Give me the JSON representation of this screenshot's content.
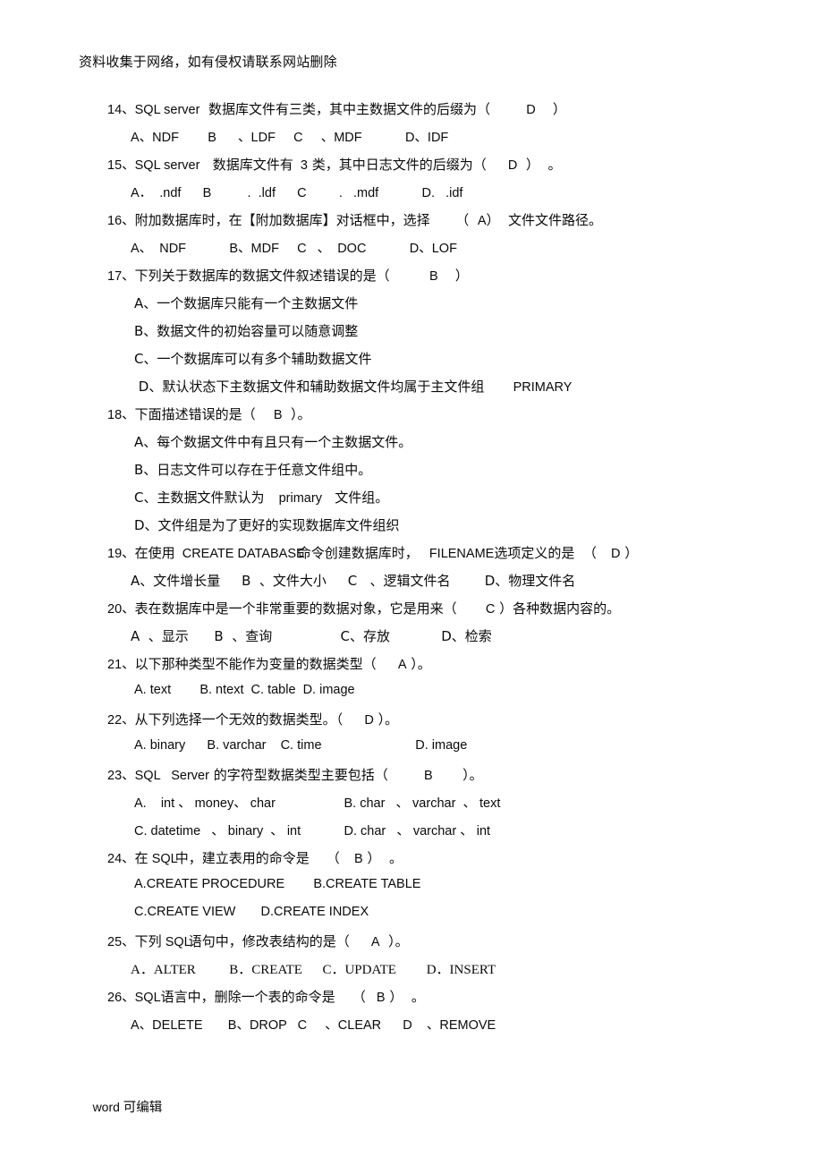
{
  "document": {
    "header_note": "资料收集于网络，如有侵权请联系网站删除",
    "footer_note_latin": "word ",
    "footer_note_cn": "可编辑"
  },
  "questions": [
    {
      "number": "14、",
      "stem_a": "SQL server",
      "stem_b": "数据库文件有三类，其中主数据文件的后缀为（",
      "answer": "D",
      "stem_c": "）",
      "options_line": "A、NDF        B      、LDF     C     、MDF            D、IDF"
    },
    {
      "number": "15、",
      "stem_a": "SQL server",
      "stem_b": "数据库文件有",
      "stem_num": "3",
      "stem_b2": "类，其中日志文件的后缀为（",
      "answer": "D",
      "stem_c": "）  。",
      "options_line": "A．  .ndf      B          .  .ldf      C         .   .mdf            D.   .idf"
    },
    {
      "number": "16、",
      "stem_b": "附加数据库时，在【附加数据库】对话框中，选择",
      "paren_open": "（  ",
      "answer": "A",
      "paren_close": "）",
      "stem_c": "  文件文件路径。",
      "options_line": "A、  NDF            B、MDF     C   、  DOC            D、LOF"
    },
    {
      "number": "17、",
      "stem_b": "下列关于数据库的数据文件叙述错误的是（",
      "answer": "B",
      "stem_c": "）",
      "options": [
        "A、一个数据库只能有一个主数据文件",
        "B、数据文件的初始容量可以随意调整",
        "C、一个数据库可以有多个辅助数据文件"
      ],
      "option_d_cn": " D、默认状态下主数据文件和辅助数据文件均属于主文件组",
      "option_d_latin": "PRIMARY"
    },
    {
      "number": "18、",
      "stem_b": "下面描述错误的是（",
      "answer": "B",
      "stem_c": "）。",
      "options": [
        "A、每个数据文件中有且只有一个主数据文件。",
        "B、日志文件可以存在于任意文件组中。"
      ],
      "option_c_pre": "C、主数据文件默认为",
      "option_c_mid": "primary",
      "option_c_post": "文件组。",
      "option_d": "D、文件组是为了更好的实现数据库文件组织"
    },
    {
      "number": "19、",
      "stem_a": "在使用",
      "stem_cmd": "CREATE DATABASE",
      "stem_b": "命令创建数据库时，",
      "stem_opt": "FILENAME",
      "stem_b2": "选项定义的是",
      "paren_open": "（",
      "answer": "D",
      "paren_close": "）",
      "options_line": "A、文件增长量     B  、文件大小     C   、逻辑文件名        D、物理文件名"
    },
    {
      "number": "20、",
      "stem_b": "表在数据库中是一个非常重要的数据对象，它是用来（",
      "answer": "C",
      "stem_c": "）各种数据内容的。",
      "options_line": "A  、显示      B  、查询                C、存放            D、检索"
    },
    {
      "number": "21、",
      "stem_b": "以下那种类型不能作为变量的数据类型（",
      "answer": "A",
      "stem_c": "）。",
      "options_line": "A. text        B. ntext  C. table  D. image"
    },
    {
      "number": "22、",
      "stem_b": "从下列选择一个无效的数据类型。（",
      "answer": "D",
      "stem_c": "）。",
      "options_line": "A. binary      B. varchar    C. time                          D. image"
    },
    {
      "number": "23、",
      "stem_a": "SQL   Server",
      "stem_b": "的字符型数据类型主要包括（",
      "answer": "B",
      "stem_c": "）。",
      "opt_row1_left": "A.    int 、 money、 char",
      "opt_row1_right": "B. char   、 varchar  、 text",
      "opt_row2_left": "C. datetime   、 binary  、 int",
      "opt_row2_right": "D. char   、 varchar 、 int"
    },
    {
      "number": "24、",
      "stem_pre": "在",
      "stem_sql": "SQL",
      "stem_b": "中，建立表用的命令是",
      "paren_open": "（",
      "answer": "B",
      "paren_close": "）",
      "stem_c": "  。",
      "opt_row1_left": "A.CREATE PROCEDURE",
      "opt_row1_right": "B.CREATE TABLE",
      "opt_row2_left": "C.CREATE VIEW",
      "opt_row2_right": "D.CREATE INDEX"
    },
    {
      "number": "25、",
      "stem_pre": "下列",
      "stem_sql": "SQL",
      "stem_b": "语句中，修改表结构的是（",
      "answer": "A",
      "stem_c": "）。",
      "options_line": "A．ALTER          B．CREATE      C．UPDATE         D．INSERT"
    },
    {
      "number": "26、",
      "stem_sql": "SQL",
      "stem_b": "语言中，删除一个表的命令是",
      "paren_open": "（",
      "answer": "B",
      "paren_close": "）",
      "stem_c": "  。",
      "options_line": "A、DELETE       B、DROP   C     、CLEAR      D    、REMOVE"
    }
  ]
}
